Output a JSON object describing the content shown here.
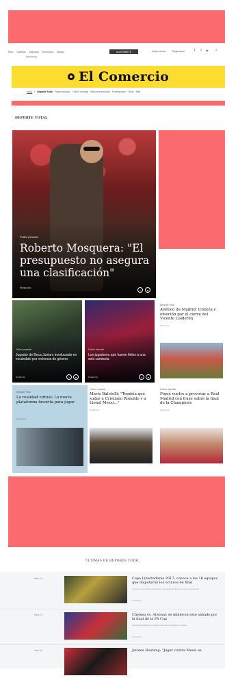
{
  "header": {
    "top_links": [
      "Perú",
      "Sucesos",
      "Deportes",
      "Economía",
      "Mundo"
    ],
    "subscribe_label": "SUSCRÍBETE",
    "right_links": [
      "Iniciar sesión",
      "Registrarse"
    ],
    "sub_link": "Beneficios",
    "social_icons": [
      "facebook-icon",
      "twitter-icon",
      "youtube-icon",
      "search-icon"
    ]
  },
  "masthead": {
    "logo": "El Comercio"
  },
  "nav": {
    "home": "Inicio",
    "section": "Deporte Total",
    "items": [
      "Fútbol peruano",
      "Fútbol mundial",
      "Selección peruana",
      "Polideportivo",
      "Tenis",
      "Más"
    ]
  },
  "section": {
    "title": "DEPORTE TOTAL"
  },
  "hero": {
    "kicker": "Fútbol peruano",
    "headline": "Roberto Mosquera: \"El presupuesto no asegura una clasificación\"",
    "byline": "Redacción"
  },
  "cards_row1": [
    {
      "kicker": "Fútbol mundial",
      "title": "Jugador de Boca Juniors involucrado en escándalo por violencia de género",
      "byline": "Redacción"
    },
    {
      "kicker": "Fútbol mundial",
      "title": "Los jugadores que fueron fieles a una sola camiseta",
      "byline": "Redacción"
    }
  ],
  "text_article_1": {
    "kicker": "Deporte Total",
    "title": "Atlético de Madrid: tristeza y emoción por el cierre del Vicente Calderón",
    "byline": "Redacción"
  },
  "vr_article": {
    "kicker": "Deporte Total",
    "title": "La realidad virtual: La nueva plataforma favorita para jugar",
    "byline": "Redacción"
  },
  "text_article_2": {
    "kicker": "Fútbol mundial",
    "title": "Mario Balotelli: \"Tendría que sudar a Cristiano Ronaldo y a Lionel Messi...\"",
    "byline": "Redacción"
  },
  "text_article_3": {
    "kicker": "Fútbol mundial",
    "title": "Piqué vuelve a provocar a Real Madrid con frase sobre la final de la Champions",
    "byline": "Redacción"
  },
  "latest": {
    "title": "ÚLTIMAS DE DEPORTE TOTAL",
    "items": [
      {
        "meta": "Hace 1 h",
        "title": "Copa Libertadores 2017: conoce a los 16 equipos que disputarán los octavos de final",
        "desc": "Conoce a los clubes clasificados a la siguiente fase del torneo continental.",
        "byline": "Redacción"
      },
      {
        "meta": "Hace 2 h",
        "title": "Chelsea vs. Arsenal: se midieron este sábado por la final de la FA Cup",
        "desc": "Los blues buscaban el doblete tras ganar la Premier League.",
        "byline": "Redacción"
      },
      {
        "meta": "Hace 3 h",
        "title": "Jerome Boateng: \"Jugar contra Messi es",
        "desc": "",
        "byline": ""
      }
    ]
  },
  "colors": {
    "ad": "#fb6a6c",
    "masthead": "#fcdc2e",
    "vr_box": "#b9d4e3"
  }
}
